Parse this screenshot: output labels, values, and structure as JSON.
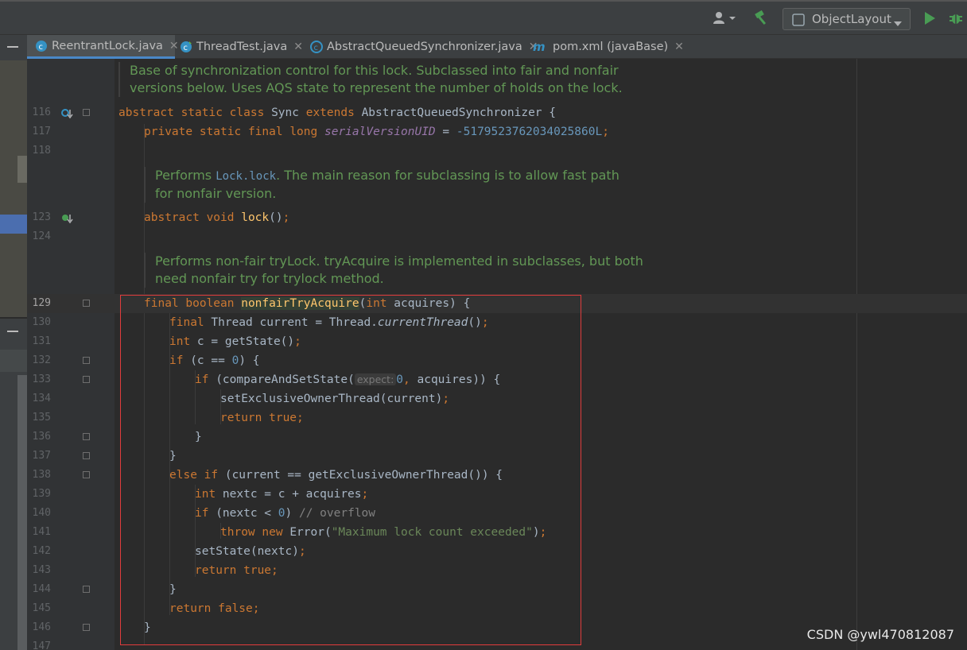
{
  "toolbar": {
    "run_config": "ObjectLayout",
    "icons": [
      "user-icon",
      "hammer-icon",
      "run-icon",
      "debug-icon"
    ]
  },
  "tabs": [
    {
      "label": "ReentrantLock.java",
      "icon": "class-icon",
      "active": true
    },
    {
      "label": "ThreadTest.java",
      "icon": "class-icon",
      "active": false
    },
    {
      "label": "AbstractQueuedSynchronizer.java",
      "icon": "class-icon",
      "active": false
    },
    {
      "label": "pom.xml (javaBase)",
      "icon": "maven-icon",
      "active": false
    }
  ],
  "editor": {
    "doc1": "Base of synchronization control for this lock. Subclassed into fair and nonfair versions below. Uses AQS state to represent the number of holds on the lock.",
    "doc2_a": "Performs ",
    "doc2_code": "Lock.lock",
    "doc2_b": ". The main reason for subclassing is to allow fast path for nonfair version.",
    "doc3": "Performs non-fair tryLock. tryAcquire is implemented in subclasses, but both need nonfair try for trylock method.",
    "line_numbers": {
      "l116": "116",
      "l117": "117",
      "l118": "118",
      "l123": "123",
      "l124": "124",
      "l129": "129",
      "l130": "130",
      "l131": "131",
      "l132": "132",
      "l133": "133",
      "l134": "134",
      "l135": "135",
      "l136": "136",
      "l137": "137",
      "l138": "138",
      "l139": "139",
      "l140": "140",
      "l141": "141",
      "l142": "142",
      "l143": "143",
      "l144": "144",
      "l145": "145",
      "l146": "146",
      "l147": "147"
    },
    "code": {
      "sync_kw": "abstract static class ",
      "sync_name": "Sync ",
      "sync_ext": "extends ",
      "sync_rest": "AbstractQueuedSynchronizer {",
      "serial_kw": "private static final long ",
      "serial_name": "serialVersionUID",
      "serial_eq": " = ",
      "serial_val": "-5179523762034025860L",
      "serial_semi": ";",
      "lock_kw": "abstract void ",
      "lock_name": "lock",
      "lock_rest": "()",
      "lock_semi": ";",
      "nfta_kw": "final boolean ",
      "nfta_name": "nonfairTryAcquire",
      "nfta_p1": "(",
      "nfta_int": "int ",
      "nfta_rest": "acquires) {",
      "l130_kw": "final ",
      "l130_a": "Thread current = Thread.",
      "l130_m": "currentThread",
      "l130_b": "()",
      "l130_semi": ";",
      "l131_kw": "int ",
      "l131_a": "c = getState()",
      "l131_semi": ";",
      "l132_kw": "if ",
      "l132_a": "(c == ",
      "l132_n": "0",
      "l132_b": ") {",
      "l133_kw": "if ",
      "l133_a": "(compareAndSetState(",
      "l133_hint": "expect:",
      "l133_n": "0",
      "l133_c": ",",
      "l133_b": " acquires)) {",
      "l134_a": "setExclusiveOwnerThread(current)",
      "l134_semi": ";",
      "l135_kw": "return true",
      "l135_semi": ";",
      "l136": "}",
      "l137": "}",
      "l138_kw": "else if ",
      "l138_a": "(current == getExclusiveOwnerThread()) {",
      "l139_kw": "int ",
      "l139_a": "nextc = c + acquires",
      "l139_semi": ";",
      "l140_kw": "if ",
      "l140_a": "(nextc < ",
      "l140_n": "0",
      "l140_b": ") ",
      "l140_c": "// overflow",
      "l141_kw": "throw new ",
      "l141_a": "Error(",
      "l141_s": "\"Maximum lock count exceeded\"",
      "l141_b": ")",
      "l141_semi": ";",
      "l142_a": "setState(nextc)",
      "l142_semi": ";",
      "l143_kw": "return true",
      "l143_semi": ";",
      "l144": "}",
      "l145_kw": "return false",
      "l145_semi": ";",
      "l146": "}"
    }
  },
  "watermark": "CSDN @ywl470812087",
  "colors": {
    "keyword": "#cc7832",
    "number": "#6897bb",
    "string": "#6a8759",
    "doc": "#629755",
    "highlight_box": "#e03c3c"
  }
}
